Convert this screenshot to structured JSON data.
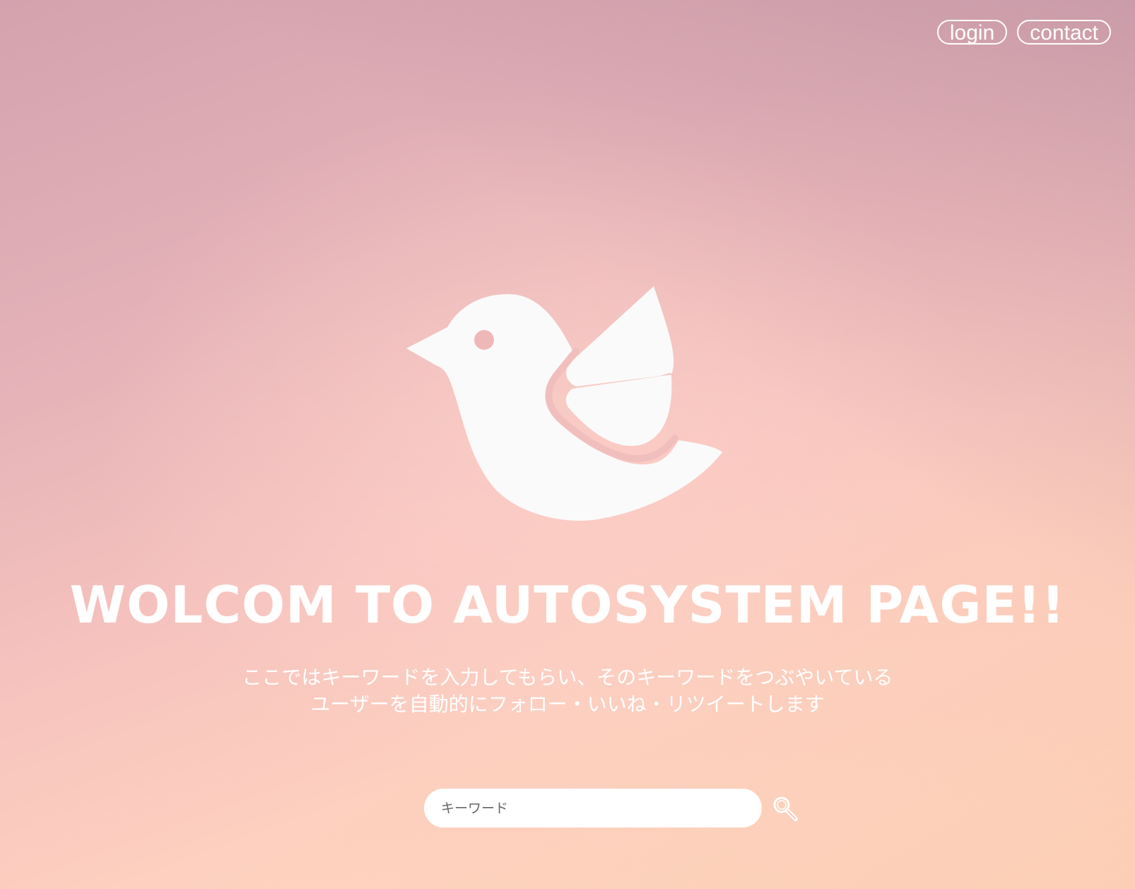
{
  "nav": {
    "login_label": "login",
    "contact_label": "contact"
  },
  "hero": {
    "title": "WOLCOM TO AUTOSYSTEM PAGE!!",
    "description_line1": "ここではキーワードを入力してもらい、そのキーワードをつぶやいている",
    "description_line2": "ユーザーを自動的にフォロー・いいね・リツイートします"
  },
  "search": {
    "placeholder": "キーワード",
    "value": ""
  },
  "icons": {
    "logo": "bird-logo-icon",
    "search": "search-icon"
  },
  "colors": {
    "foreground": "#ffffff",
    "bird": "#fafafa"
  }
}
